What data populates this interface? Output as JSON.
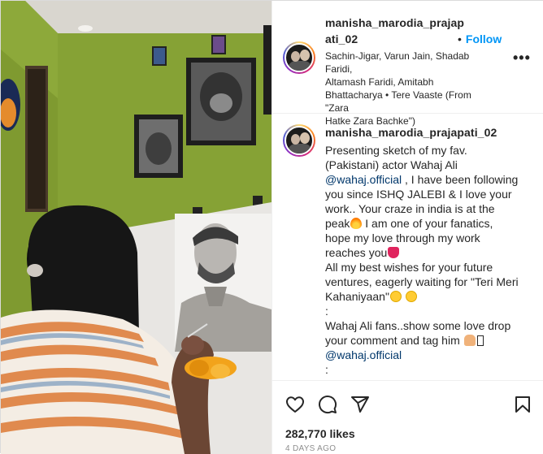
{
  "post": {
    "author": {
      "username": "manisha_marodia_prajapati_02",
      "header_username_line1": "manisha_marodia_prajap",
      "header_username_line2": "ati_02"
    },
    "follow_label": "Follow",
    "follow_separator": "•",
    "audio_line1": "Sachin-Jigar, Varun Jain, Shadab Faridi,",
    "audio_line2": "Altamash Faridi, Amitabh",
    "audio_line3": "Bhattacharya • Tere Vaaste (From \"Zara",
    "audio_line4": "Hatke Zara Bachke\")",
    "more_glyph": "•••",
    "caption": {
      "l1": "Presenting sketch of my fav.",
      "l2": "(Pakistani) actor Wahaj Ali",
      "mention1": "@wahaj.official",
      "l3_rest": " , I have been following",
      "l4": "you since ISHQ JALEBI & I love your",
      "l5": "work.. Your craze in india is at the",
      "l6": "peak",
      "l6_rest": " I am one of your fanatics,",
      "l7": "hope my love through my work",
      "l8": "reaches you",
      "l9": "All my best wishes for your future",
      "l10": "ventures, eagerly waiting for \"Teri Meri",
      "l11": "Kahaniyaan\"",
      "l12": ":",
      "l13": "Wahaj Ali fans..show some love drop",
      "l14": "your comment and tag him ",
      "mention2": "@wahaj.official",
      "l15": ":"
    },
    "likes": "282,770 likes",
    "time_ago": "4 DAYS AGO"
  },
  "icons": {
    "like": "heart-outline-icon",
    "comment": "speech-bubble-icon",
    "share": "paper-plane-icon",
    "save": "bookmark-icon",
    "more": "more-options-icon"
  },
  "colors": {
    "link_blue": "#0095f6",
    "mention": "#00376b",
    "wall_green": "#7e9a2e"
  }
}
